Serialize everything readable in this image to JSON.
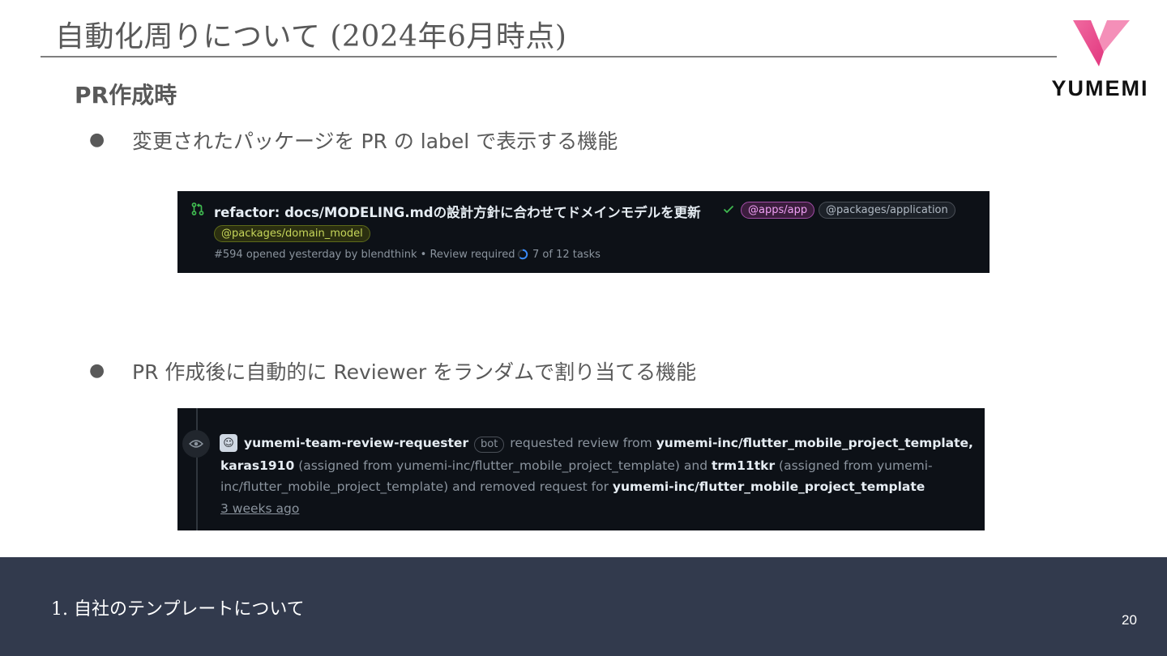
{
  "slide": {
    "title": "自動化周りについて (2024年6月時点)",
    "section_heading": "PR作成時",
    "logo_text": "YUMEMI",
    "bullets": [
      {
        "text": "変更されたパッケージを PR の label で表示する機能"
      },
      {
        "text": "PR 作成後に自動的に Reviewer をランダムで割り当てる機能"
      }
    ]
  },
  "pr_item": {
    "title": "refactor: docs/MODELING.mdの設計方針に合わせてドメインモデルを更新",
    "labels": [
      "@apps/app",
      "@packages/application",
      "@packages/domain_model"
    ],
    "meta": "#594 opened yesterday by blendthink • Review required",
    "tasks": "7 of 12 tasks",
    "colors": {
      "app_label": "#f0a0f5",
      "pkg_label": "#b1bac4",
      "domain_label": "#c6d65a",
      "pr_open": "#3fb950"
    }
  },
  "timeline_event": {
    "actor": "yumemi-team-review-requester",
    "bot_badge": "bot",
    "line1_text": "requested review from",
    "line1_target": "yumemi-inc/flutter_mobile_project_template,",
    "line2_user1": "karas1910",
    "line2_text1": "(assigned from yumemi-inc/flutter_mobile_project_template) and",
    "line2_user2": "trm11tkr",
    "line2_text2": "(assigned from yumemi-",
    "line3_text": "inc/flutter_mobile_project_template) and removed request for",
    "line3_target": "yumemi-inc/flutter_mobile_project_template",
    "time": "3 weeks ago"
  },
  "footer": {
    "section": "1.  自社のテンプレートについて",
    "page_number": "20"
  }
}
